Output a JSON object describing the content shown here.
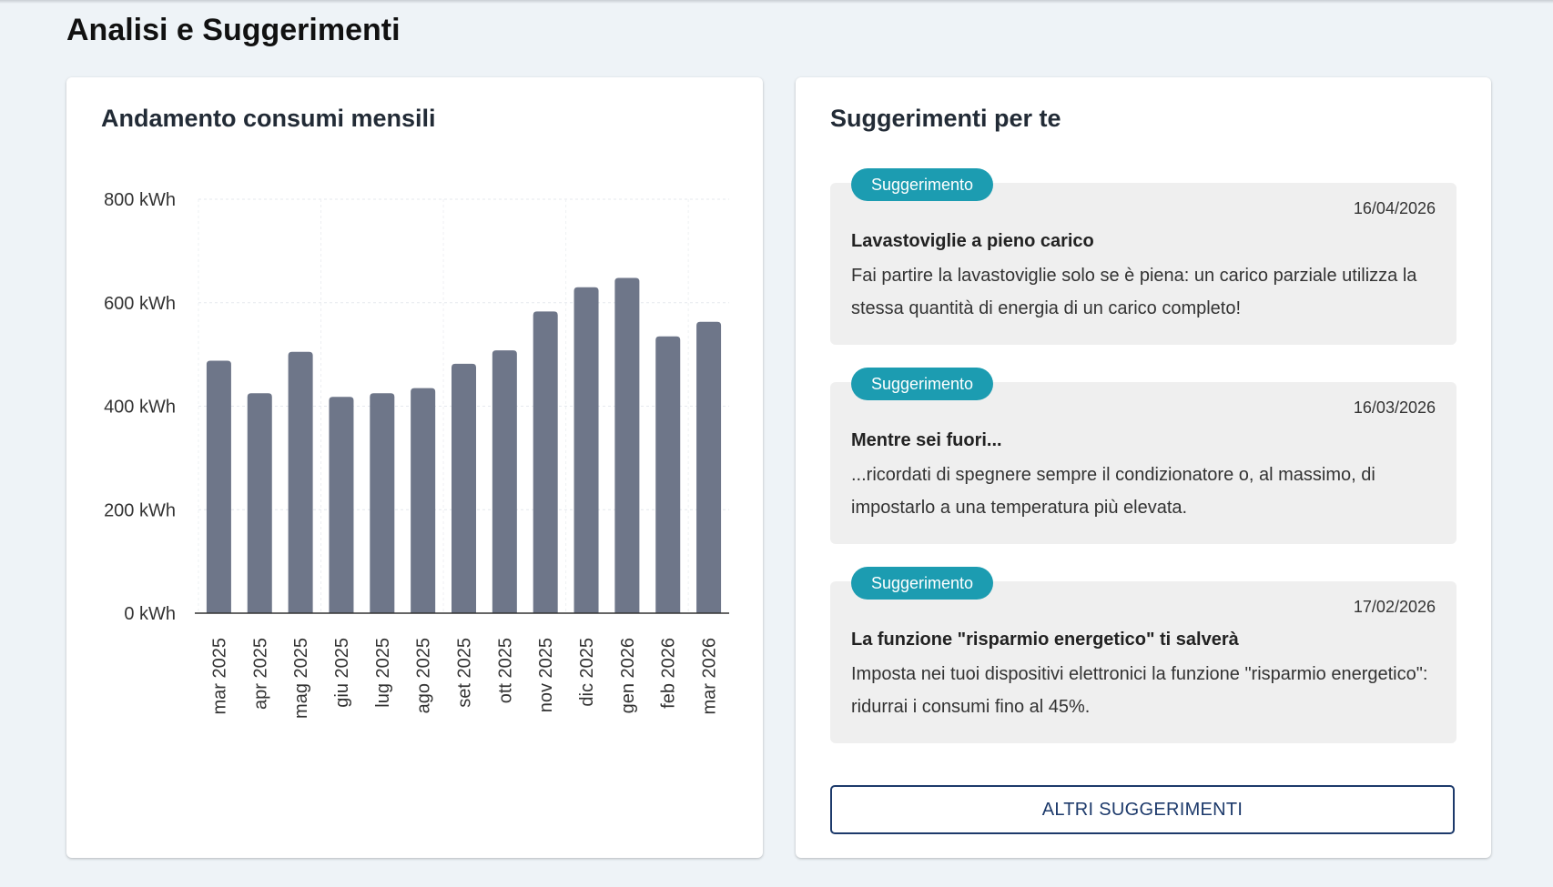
{
  "page": {
    "title": "Analisi e Suggerimenti"
  },
  "chart_card": {
    "title": "Andamento consumi mensili"
  },
  "chart_data": {
    "type": "bar",
    "title": "Andamento consumi mensili",
    "categories": [
      "mar 2025",
      "apr 2025",
      "mag 2025",
      "giu 2025",
      "lug 2025",
      "ago 2025",
      "set 2025",
      "ott 2025",
      "nov 2025",
      "dic 2025",
      "gen 2026",
      "feb 2026",
      "mar 2026"
    ],
    "values": [
      488,
      425,
      505,
      418,
      425,
      435,
      482,
      508,
      583,
      630,
      648,
      535,
      563
    ],
    "ylim": [
      0,
      800
    ],
    "yticks": [
      0,
      200,
      400,
      600,
      800
    ],
    "ytick_labels": [
      "0 kWh",
      "200 kWh",
      "400 kWh",
      "600 kWh",
      "800 kWh"
    ],
    "grid": true,
    "bar_color": "#6e7689"
  },
  "tips_card": {
    "title": "Suggerimenti per te",
    "items": [
      {
        "badge": "Suggerimento",
        "date": "16/04/2026",
        "title": "Lavastoviglie a pieno carico",
        "text": "Fai partire la lavastoviglie solo se è piena: un carico parziale utilizza la stessa quantità di energia di un carico completo!"
      },
      {
        "badge": "Suggerimento",
        "date": "16/03/2026",
        "title": "Mentre sei fuori...",
        "text": "...ricordati di spegnere sempre il condizionatore o, al massimo, di impostarlo a una temperatura più elevata."
      },
      {
        "badge": "Suggerimento",
        "date": "17/02/2026",
        "title": "La funzione \"risparmio energetico\" ti salverà",
        "text": "Imposta nei tuoi dispositivi elettronici la funzione \"risparmio energetico\": ridurrai i consumi fino al 45%."
      }
    ],
    "more_button": "ALTRI SUGGERIMENTI"
  },
  "colors": {
    "accent": "#1c9cb1",
    "button": "#1d3a6b",
    "bar": "#6e7689",
    "background": "#eef3f7"
  }
}
